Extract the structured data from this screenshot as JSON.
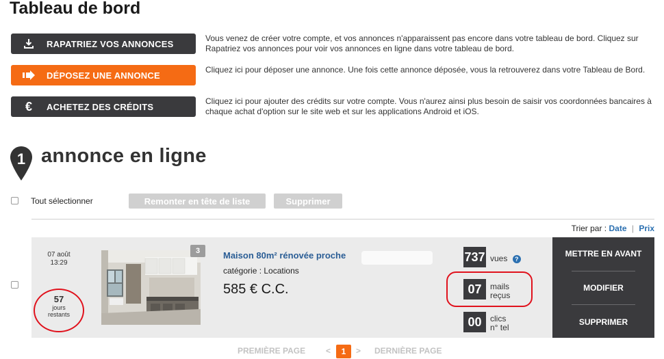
{
  "page": {
    "title": "Tableau de bord"
  },
  "actions": [
    {
      "label": "RAPATRIEZ VOS ANNONCES",
      "icon": "download-icon",
      "style": "dark",
      "description": "Vous venez de créer votre compte, et vos annonces n'apparaissent pas encore dans votre tableau de bord. Cliquez sur Rapatriez vos annonces pour voir vos annonces en ligne dans votre tableau de bord."
    },
    {
      "label": "DÉPOSEZ UNE ANNONCE",
      "icon": "arrow-right-icon",
      "style": "orange",
      "description": "Cliquez ici pour déposer une annonce. Une fois cette annonce déposée, vous la retrouverez dans votre Tableau de Bord."
    },
    {
      "label": "ACHETEZ DES CRÉDITS",
      "icon": "euro-icon",
      "style": "dark",
      "description": "Cliquez ici pour ajouter des crédits sur votre compte. Vous n'aurez ainsi plus besoin de saisir vos coordonnées bancaires à chaque achat d'option sur le site web et sur les applications Android et iOS."
    }
  ],
  "section": {
    "count": "1",
    "title": "annonce en ligne"
  },
  "toolbar": {
    "select_all": "Tout sélectionner",
    "bump": "Remonter en tête de liste",
    "delete": "Supprimer"
  },
  "sort": {
    "label": "Trier par :",
    "date": "Date",
    "separator": "|",
    "price": "Prix"
  },
  "listing": {
    "date_day": "07 août",
    "date_time": "13:29",
    "days_left": "57",
    "days_word": "jours",
    "days_suffix": "restants",
    "photo_count": "3",
    "title": "Maison 80m² rénovée proche",
    "category": "catégorie : Locations",
    "price": "585 € C.C.",
    "stats": {
      "views": "737",
      "views_label": "vues",
      "help": "?",
      "mails": "07",
      "mails_label_1": "mails",
      "mails_label_2": "reçus",
      "clicks": "00",
      "clicks_label_1": "clics",
      "clicks_label_2": "n° tel"
    },
    "menu": {
      "feature": "METTRE EN AVANT",
      "edit": "MODIFIER",
      "delete": "SUPPRIMER"
    }
  },
  "pager": {
    "first": "PREMIÈRE PAGE",
    "prev": "<",
    "current": "1",
    "next": ">",
    "last": "DERNIÈRE PAGE"
  },
  "colors": {
    "accent": "#f56b14",
    "dark": "#3a3a3d",
    "link": "#2a6fb0",
    "highlight_ring": "#e0111c"
  }
}
